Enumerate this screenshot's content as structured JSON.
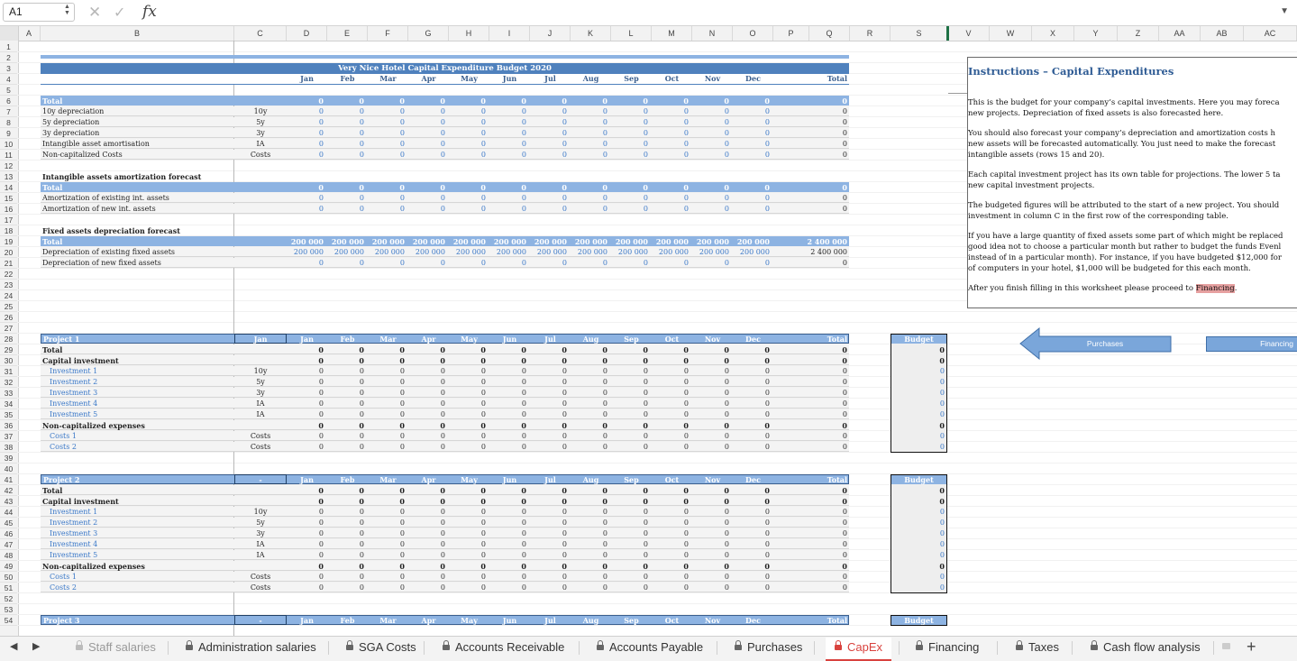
{
  "formula_bar": {
    "cell_ref": "A1",
    "cancel_icon": "x-icon",
    "confirm_icon": "check-icon",
    "fx_label": "fx",
    "formula": ""
  },
  "columns": [
    "A",
    "B",
    "C",
    "D",
    "E",
    "F",
    "G",
    "H",
    "I",
    "J",
    "K",
    "L",
    "M",
    "N",
    "O",
    "P",
    "Q",
    "R",
    "S",
    "V",
    "W",
    "X",
    "Y",
    "Z",
    "AA",
    "AB",
    "AC"
  ],
  "row_numbers": [
    "1",
    "2",
    "3",
    "4",
    "5",
    "6",
    "7",
    "8",
    "9",
    "10",
    "11",
    "12",
    "13",
    "14",
    "15",
    "16",
    "17",
    "18",
    "19",
    "20",
    "21",
    "22",
    "23",
    "24",
    "25",
    "26",
    "27",
    "28",
    "29",
    "30",
    "31",
    "32",
    "33",
    "34",
    "35",
    "36",
    "37",
    "38",
    "39",
    "40",
    "41",
    "42",
    "43",
    "44",
    "45",
    "46",
    "47",
    "48",
    "49",
    "50",
    "51",
    "52",
    "53",
    "54"
  ],
  "budget_title": "Very Nice Hotel Capital Expenditure Budget 2020",
  "months": [
    "Jan",
    "Feb",
    "Mar",
    "Apr",
    "May",
    "Jun",
    "Jul",
    "Aug",
    "Sep",
    "Oct",
    "Nov",
    "Dec"
  ],
  "total_label": "Total",
  "summary_rows": [
    {
      "label": "Total",
      "code": "",
      "values": [
        "0",
        "0",
        "0",
        "0",
        "0",
        "0",
        "0",
        "0",
        "0",
        "0",
        "0",
        "0"
      ],
      "total": "0",
      "style": "band"
    },
    {
      "label": "10y depreciation",
      "code": "10y",
      "values": [
        "0",
        "0",
        "0",
        "0",
        "0",
        "0",
        "0",
        "0",
        "0",
        "0",
        "0",
        "0"
      ],
      "total": "0",
      "style": "data"
    },
    {
      "label": "5y depreciation",
      "code": "5y",
      "values": [
        "0",
        "0",
        "0",
        "0",
        "0",
        "0",
        "0",
        "0",
        "0",
        "0",
        "0",
        "0"
      ],
      "total": "0",
      "style": "data"
    },
    {
      "label": "3y depreciation",
      "code": "3y",
      "values": [
        "0",
        "0",
        "0",
        "0",
        "0",
        "0",
        "0",
        "0",
        "0",
        "0",
        "0",
        "0"
      ],
      "total": "0",
      "style": "data"
    },
    {
      "label": "Intangible asset amortisation",
      "code": "IA",
      "values": [
        "0",
        "0",
        "0",
        "0",
        "0",
        "0",
        "0",
        "0",
        "0",
        "0",
        "0",
        "0"
      ],
      "total": "0",
      "style": "data"
    },
    {
      "label": "Non-capitalized Costs",
      "code": "Costs",
      "values": [
        "0",
        "0",
        "0",
        "0",
        "0",
        "0",
        "0",
        "0",
        "0",
        "0",
        "0",
        "0"
      ],
      "total": "0",
      "style": "data"
    }
  ],
  "intangible": {
    "header": "Intangible assets amortization forecast",
    "rows": [
      {
        "label": "Total",
        "values": [
          "0",
          "0",
          "0",
          "0",
          "0",
          "0",
          "0",
          "0",
          "0",
          "0",
          "0",
          "0"
        ],
        "total": "0",
        "style": "band"
      },
      {
        "label": "Amortization of existing int. assets",
        "values": [
          "0",
          "0",
          "0",
          "0",
          "0",
          "0",
          "0",
          "0",
          "0",
          "0",
          "0",
          "0"
        ],
        "total": "0",
        "style": "data"
      },
      {
        "label": "Amortization of new int. assets",
        "values": [
          "0",
          "0",
          "0",
          "0",
          "0",
          "0",
          "0",
          "0",
          "0",
          "0",
          "0",
          "0"
        ],
        "total": "0",
        "style": "data"
      }
    ]
  },
  "fixed": {
    "header": "Fixed assets depreciation forecast",
    "rows": [
      {
        "label": "Total",
        "values": [
          "200 000",
          "200 000",
          "200 000",
          "200 000",
          "200 000",
          "200 000",
          "200 000",
          "200 000",
          "200 000",
          "200 000",
          "200 000",
          "200 000"
        ],
        "total": "2 400 000",
        "style": "band"
      },
      {
        "label": "Depreciation of existing fixed assets",
        "values": [
          "200 000",
          "200 000",
          "200 000",
          "200 000",
          "200 000",
          "200 000",
          "200 000",
          "200 000",
          "200 000",
          "200 000",
          "200 000",
          "200 000"
        ],
        "total": "2 400 000",
        "style": "data"
      },
      {
        "label": "Depreciation of new fixed assets",
        "values": [
          "0",
          "0",
          "0",
          "0",
          "0",
          "0",
          "0",
          "0",
          "0",
          "0",
          "0",
          "0"
        ],
        "total": "0",
        "style": "data"
      }
    ]
  },
  "projects": [
    {
      "name": "Project 1",
      "start": "Jan",
      "budget_label": "Budget",
      "rows": [
        {
          "label": "Total",
          "code": "",
          "kind": "bold",
          "budget": "0"
        },
        {
          "label": "Capital investment",
          "code": "",
          "kind": "bold",
          "budget": "0"
        },
        {
          "label": "Investment 1",
          "code": "10y",
          "kind": "item",
          "budget": "0"
        },
        {
          "label": "Investment 2",
          "code": "5y",
          "kind": "item",
          "budget": "0"
        },
        {
          "label": "Investment 3",
          "code": "3y",
          "kind": "item",
          "budget": "0"
        },
        {
          "label": "Investment 4",
          "code": "IA",
          "kind": "item",
          "budget": "0"
        },
        {
          "label": "Investment 5",
          "code": "IA",
          "kind": "item",
          "budget": "0"
        },
        {
          "label": "Non-capitalized expenses",
          "code": "",
          "kind": "bold",
          "budget": "0"
        },
        {
          "label": "Costs 1",
          "code": "Costs",
          "kind": "item",
          "budget": "0"
        },
        {
          "label": "Costs 2",
          "code": "Costs",
          "kind": "item",
          "budget": "0"
        }
      ]
    },
    {
      "name": "Project 2",
      "start": "-",
      "budget_label": "Budget",
      "rows": [
        {
          "label": "Total",
          "code": "",
          "kind": "bold",
          "budget": "0"
        },
        {
          "label": "Capital investment",
          "code": "",
          "kind": "bold",
          "budget": "0"
        },
        {
          "label": "Investment 1",
          "code": "10y",
          "kind": "item",
          "budget": "0"
        },
        {
          "label": "Investment 2",
          "code": "5y",
          "kind": "item",
          "budget": "0"
        },
        {
          "label": "Investment 3",
          "code": "3y",
          "kind": "item",
          "budget": "0"
        },
        {
          "label": "Investment 4",
          "code": "IA",
          "kind": "item",
          "budget": "0"
        },
        {
          "label": "Investment 5",
          "code": "IA",
          "kind": "item",
          "budget": "0"
        },
        {
          "label": "Non-capitalized expenses",
          "code": "",
          "kind": "bold",
          "budget": "0"
        },
        {
          "label": "Costs 1",
          "code": "Costs",
          "kind": "item",
          "budget": "0"
        },
        {
          "label": "Costs 2",
          "code": "Costs",
          "kind": "item",
          "budget": "0"
        }
      ]
    },
    {
      "name": "Project 3",
      "start": "-",
      "budget_label": "Budget",
      "rows": []
    }
  ],
  "zero": "0",
  "instructions": {
    "title": "Instructions – Capital Expenditures",
    "paragraphs": [
      [
        "This is the budget for your company’s capital investments. Here you may foreca",
        "new projects. Depreciation of fixed assets is also forecasted here."
      ],
      [
        "You should also forecast your company’s depreciation and amortization costs h",
        "new assets will be forecasted automatically. You just need to make the forecast",
        "intangible assets (rows 15 and 20)."
      ],
      [
        "Each capital investment project has its own table for projections. The lower 5 ta",
        "new capital investment projects."
      ],
      [
        "The budgeted figures will be attributed to the start of a new project. You should",
        "investment in column C in the first row of the corresponding table."
      ],
      [
        "If you have a large quantity of fixed assets some part of which might be replaced",
        "good idea not to choose a particular month but rather to budget the funds Evenl",
        "instead of in a particular month). For instance, if you have budgeted $12,000 for",
        "of computers in your hotel, $1,000 will be budgeted for this each month."
      ]
    ],
    "last_line_prefix": "After you finish filling in this worksheet please proceed to ",
    "last_line_link": "Financing",
    "last_line_suffix": "."
  },
  "nav_buttons": {
    "purchases": "Purchases",
    "financing": "Financing"
  },
  "sheet_tabs": [
    {
      "label": "Staff salaries",
      "locked": true,
      "active": false
    },
    {
      "label": "Administration salaries",
      "locked": true,
      "active": false
    },
    {
      "label": "SGA Costs",
      "locked": true,
      "active": false
    },
    {
      "label": "Accounts Receivable",
      "locked": true,
      "active": false
    },
    {
      "label": "Accounts Payable",
      "locked": true,
      "active": false
    },
    {
      "label": "Purchases",
      "locked": true,
      "active": false
    },
    {
      "label": "CapEx",
      "locked": true,
      "active": true
    },
    {
      "label": "Financing",
      "locked": true,
      "active": false
    },
    {
      "label": "Taxes",
      "locked": true,
      "active": false
    },
    {
      "label": "Cash flow analysis",
      "locked": true,
      "active": false
    }
  ],
  "add_sheet": "+",
  "colors": {
    "band": "#8db3e2",
    "band_dark": "#4f81bd",
    "blue_text": "#3a78c8",
    "red_highlight": "#e6a0a0",
    "button": "#7aa6da",
    "grid": "#e3e3e3",
    "header_bg": "#f2f2f2",
    "active_tab": "#d9423e"
  }
}
